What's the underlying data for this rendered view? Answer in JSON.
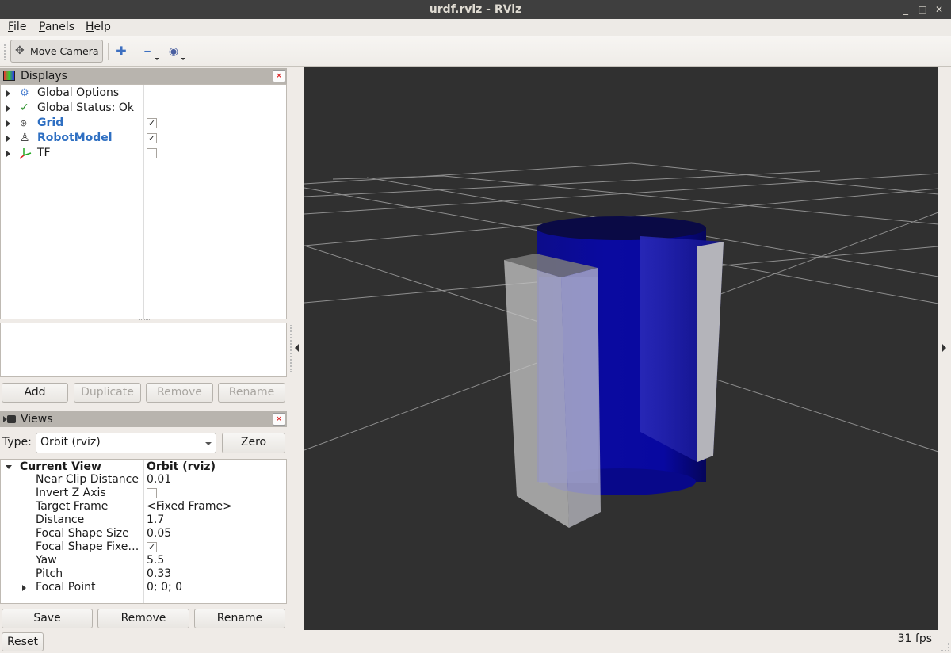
{
  "window": {
    "title": "urdf.rviz - RViz",
    "controls": {
      "minimize": "_",
      "maximize": "□",
      "close": "✕"
    }
  },
  "menubar": {
    "items": [
      {
        "label": "File",
        "mnemonic": "F",
        "rest": "ile"
      },
      {
        "label": "Panels",
        "mnemonic": "P",
        "rest": "anels"
      },
      {
        "label": "Help",
        "mnemonic": "H",
        "rest": "elp"
      }
    ]
  },
  "toolbar": {
    "move_camera_label": "Move Camera",
    "tools": [
      {
        "icon": "plus-icon",
        "glyph": "✚"
      },
      {
        "icon": "minus-icon",
        "glyph": "━"
      },
      {
        "icon": "eye-icon",
        "glyph": "◉"
      }
    ]
  },
  "displays_panel": {
    "title": "Displays",
    "close_glyph": "×",
    "items": [
      {
        "label": "Global Options",
        "icon": "gear-icon",
        "glyph": "⚙",
        "selected": false,
        "checkbox": null
      },
      {
        "label": "Global Status: Ok",
        "icon": "checkmark-icon",
        "glyph": "✓",
        "selected": false,
        "checkbox": null
      },
      {
        "label": "Grid",
        "icon": "grid-icon",
        "glyph": "⊛",
        "selected": true,
        "checkbox": true
      },
      {
        "label": "RobotModel",
        "icon": "robot-icon",
        "glyph": "♙",
        "selected": true,
        "checkbox": true
      },
      {
        "label": "TF",
        "icon": "tf-axes-icon",
        "glyph": "⅄",
        "selected": false,
        "checkbox": false
      }
    ],
    "buttons": {
      "add": "Add",
      "duplicate": "Duplicate",
      "remove": "Remove",
      "rename": "Rename"
    }
  },
  "views_panel": {
    "title": "Views",
    "close_glyph": "×",
    "type_label": "Type:",
    "type_value": "Orbit (rviz)",
    "zero_label": "Zero",
    "current_view": {
      "label": "Current View",
      "value": "Orbit (rviz)"
    },
    "properties": [
      {
        "label": "Near Clip Distance",
        "value": "0.01"
      },
      {
        "label": "Invert Z Axis",
        "checkbox": false
      },
      {
        "label": "Target Frame",
        "value": "<Fixed Frame>"
      },
      {
        "label": "Distance",
        "value": "1.7"
      },
      {
        "label": "Focal Shape Size",
        "value": "0.05"
      },
      {
        "label": "Focal Shape Fixe…",
        "checkbox": true
      },
      {
        "label": "Yaw",
        "value": "5.5"
      },
      {
        "label": "Pitch",
        "value": "0.33"
      },
      {
        "label": "Focal Point",
        "value": "0; 0; 0",
        "expandable": true
      }
    ],
    "buttons": {
      "save": "Save",
      "remove": "Remove",
      "rename": "Rename"
    }
  },
  "reset_label": "Reset",
  "status": {
    "fps": "31 fps"
  },
  "viewport": {
    "background": "#303030",
    "grid_color": "#a0a0a0",
    "cylinder_color": "#0a0a9c",
    "box_color": "#c8c8c8"
  }
}
